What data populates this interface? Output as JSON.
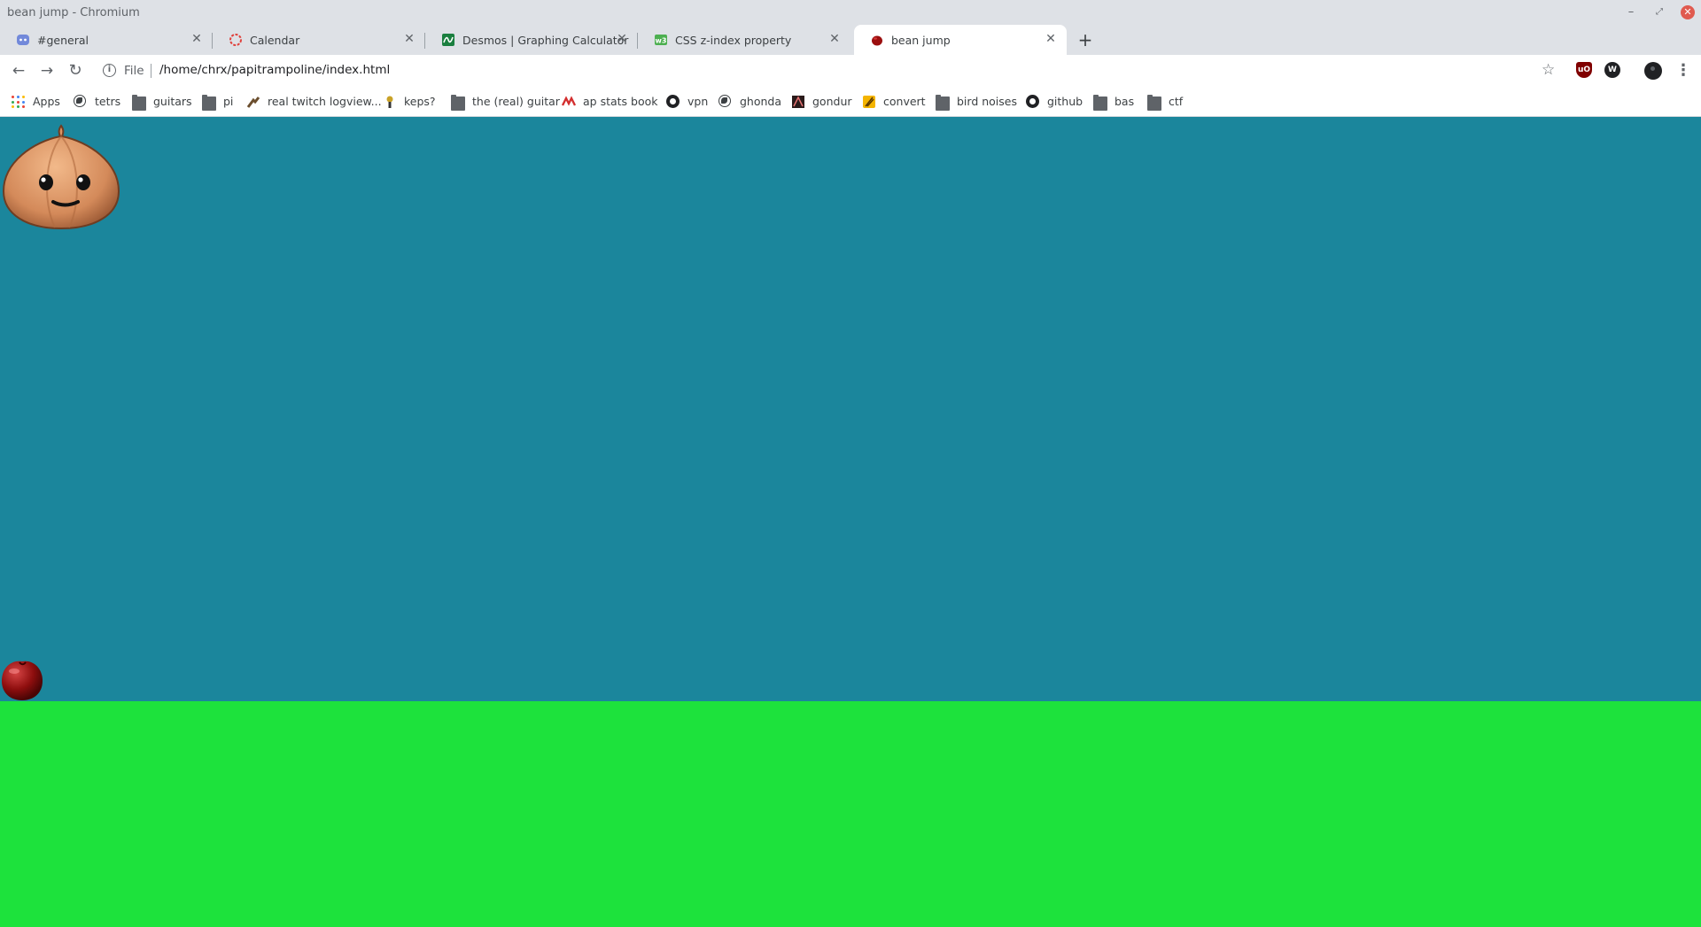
{
  "window": {
    "title": "bean jump - Chromium"
  },
  "tabs": [
    {
      "label": "#general",
      "icon": "discord-icon"
    },
    {
      "label": "Calendar",
      "icon": "calendar-icon"
    },
    {
      "label": "Desmos | Graphing Calculator",
      "icon": "desmos-icon"
    },
    {
      "label": "CSS z-index property",
      "icon": "w3schools-icon"
    },
    {
      "label": "bean jump",
      "icon": "bean-icon",
      "active": true
    }
  ],
  "toolbar": {
    "scheme": "File",
    "url": "/home/chrx/papitrampoline/index.html"
  },
  "bookmarks": [
    {
      "label": "Apps",
      "icon": "apps-icon"
    },
    {
      "label": "tetrs",
      "icon": "globe-icon"
    },
    {
      "label": "guitars",
      "icon": "folder-icon"
    },
    {
      "label": "pi",
      "icon": "folder-icon"
    },
    {
      "label": "real twitch logview...",
      "icon": "twitch-logview-icon"
    },
    {
      "label": "keps?",
      "icon": "keps-icon"
    },
    {
      "label": "the (real) guitar",
      "icon": "folder-icon"
    },
    {
      "label": "ap stats book",
      "icon": "book-icon"
    },
    {
      "label": "vpn",
      "icon": "github-icon"
    },
    {
      "label": "ghonda",
      "icon": "globe-icon"
    },
    {
      "label": "gondur",
      "icon": "gondur-icon"
    },
    {
      "label": "convert",
      "icon": "convert-icon"
    },
    {
      "label": "bird noises",
      "icon": "folder-icon"
    },
    {
      "label": "github",
      "icon": "github-icon"
    },
    {
      "label": "bas",
      "icon": "folder-icon"
    },
    {
      "label": "ctf",
      "icon": "folder-icon"
    }
  ],
  "game": {
    "sky_color": "#1b869c",
    "ground_color": "#1de23c",
    "sprites": [
      "onion-sprite",
      "bean-sprite"
    ]
  },
  "colors": {
    "chrome_frame": "#dee1e6",
    "active_tab": "#ffffff"
  }
}
